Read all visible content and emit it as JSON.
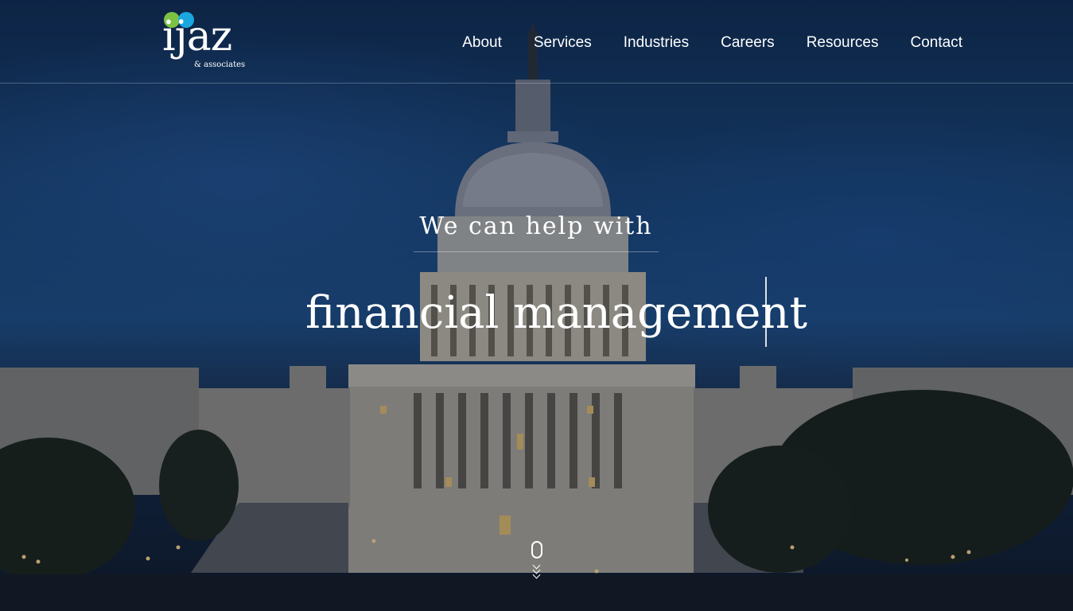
{
  "brand": {
    "name": "ijaz",
    "tagline": "& associates",
    "dot_colors": [
      "#7cc242",
      "#1aa7e0"
    ]
  },
  "nav": {
    "items": [
      {
        "label": "About"
      },
      {
        "label": "Services"
      },
      {
        "label": "Industries"
      },
      {
        "label": "Careers"
      },
      {
        "label": "Resources"
      },
      {
        "label": "Contact"
      }
    ]
  },
  "hero": {
    "subtitle": "We can help with",
    "headline": "financial management",
    "background_icon": "capitol-building-night-photo"
  },
  "scroll": {
    "icon": "mouse-scroll-icon"
  },
  "colors": {
    "sky": "#1d4b80",
    "text": "#ffffff"
  }
}
